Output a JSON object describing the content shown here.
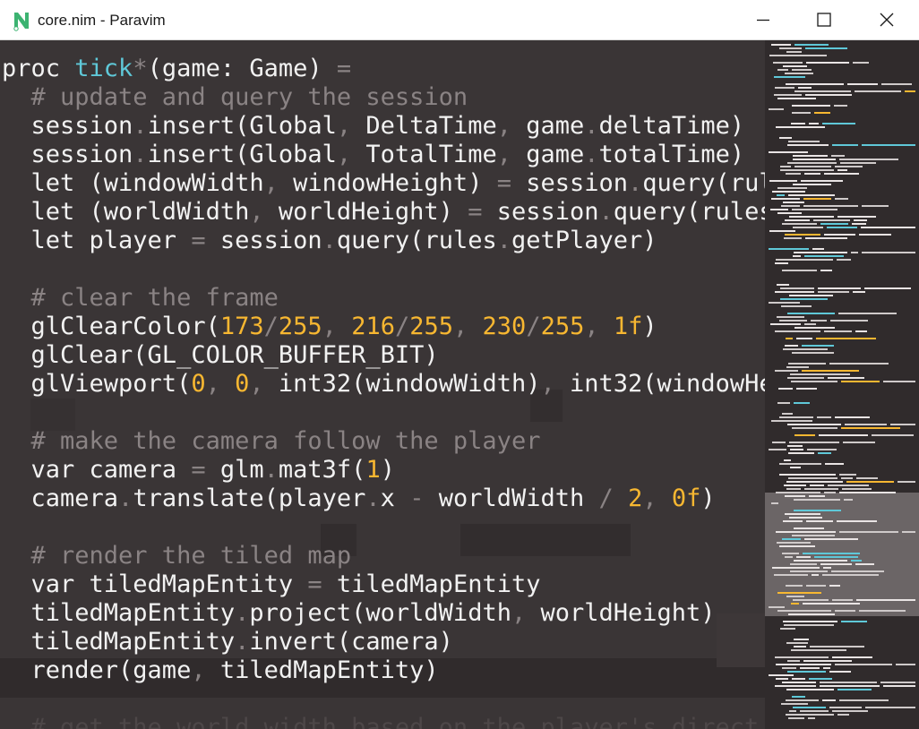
{
  "window": {
    "title": "core.nim - Paravim",
    "logo": "paravim-logo-icon",
    "controls": {
      "minimize": "minimize-icon",
      "maximize": "maximize-icon",
      "close": "close-icon"
    }
  },
  "colors": {
    "editor_bg": "#3a3536",
    "keyword": "#f2f2f2",
    "function": "#5fc8d8",
    "comment": "#8a8384",
    "number": "#f7b731",
    "logo_green": "#3cb371"
  },
  "code": {
    "lines": [
      [
        [
          "t-kw",
          "proc "
        ],
        [
          "t-fn",
          "tick"
        ],
        [
          "t-op",
          "*"
        ],
        [
          "t-tx",
          "(game: Game) "
        ],
        [
          "t-op",
          "="
        ]
      ],
      [
        [
          "t-cm",
          "  # update and query the session"
        ]
      ],
      [
        [
          "t-tx",
          "  session"
        ],
        [
          "t-op",
          "."
        ],
        [
          "t-tx",
          "insert(Global"
        ],
        [
          "t-op",
          ", "
        ],
        [
          "t-tx",
          "DeltaTime"
        ],
        [
          "t-op",
          ", "
        ],
        [
          "t-tx",
          "game"
        ],
        [
          "t-op",
          "."
        ],
        [
          "t-tx",
          "deltaTime)"
        ]
      ],
      [
        [
          "t-tx",
          "  session"
        ],
        [
          "t-op",
          "."
        ],
        [
          "t-tx",
          "insert(Global"
        ],
        [
          "t-op",
          ", "
        ],
        [
          "t-tx",
          "TotalTime"
        ],
        [
          "t-op",
          ", "
        ],
        [
          "t-tx",
          "game"
        ],
        [
          "t-op",
          "."
        ],
        [
          "t-tx",
          "totalTime)"
        ]
      ],
      [
        [
          "t-tx",
          "  let (windowWidth"
        ],
        [
          "t-op",
          ", "
        ],
        [
          "t-tx",
          "windowHeight) "
        ],
        [
          "t-op",
          "="
        ],
        [
          "t-tx",
          " session"
        ],
        [
          "t-op",
          "."
        ],
        [
          "t-tx",
          "query(rule"
        ]
      ],
      [
        [
          "t-tx",
          "  let (worldWidth"
        ],
        [
          "t-op",
          ", "
        ],
        [
          "t-tx",
          "worldHeight) "
        ],
        [
          "t-op",
          "="
        ],
        [
          "t-tx",
          " session"
        ],
        [
          "t-op",
          "."
        ],
        [
          "t-tx",
          "query(rules"
        ]
      ],
      [
        [
          "t-tx",
          "  let player "
        ],
        [
          "t-op",
          "="
        ],
        [
          "t-tx",
          " session"
        ],
        [
          "t-op",
          "."
        ],
        [
          "t-tx",
          "query(rules"
        ],
        [
          "t-op",
          "."
        ],
        [
          "t-tx",
          "getPlayer)"
        ]
      ],
      [
        [
          "t-tx",
          " "
        ]
      ],
      [
        [
          "t-cm",
          "  # clear the frame"
        ]
      ],
      [
        [
          "t-tx",
          "  glClearColor("
        ],
        [
          "t-num",
          "173"
        ],
        [
          "t-op",
          "/"
        ],
        [
          "t-num",
          "255"
        ],
        [
          "t-op",
          ", "
        ],
        [
          "t-num",
          "216"
        ],
        [
          "t-op",
          "/"
        ],
        [
          "t-num",
          "255"
        ],
        [
          "t-op",
          ", "
        ],
        [
          "t-num",
          "230"
        ],
        [
          "t-op",
          "/"
        ],
        [
          "t-num",
          "255"
        ],
        [
          "t-op",
          ", "
        ],
        [
          "t-num",
          "1f"
        ],
        [
          "t-tx",
          ")"
        ]
      ],
      [
        [
          "t-tx",
          "  glClear(GL_COLOR_BUFFER_BIT)"
        ]
      ],
      [
        [
          "t-tx",
          "  glViewport("
        ],
        [
          "t-num",
          "0"
        ],
        [
          "t-op",
          ", "
        ],
        [
          "t-num",
          "0"
        ],
        [
          "t-op",
          ", "
        ],
        [
          "t-tx",
          "int32(windowWidth)"
        ],
        [
          "t-op",
          ", "
        ],
        [
          "t-tx",
          "int32(windowHe"
        ]
      ],
      [
        [
          "t-tx",
          " "
        ]
      ],
      [
        [
          "t-cm",
          "  # make the camera follow the player"
        ]
      ],
      [
        [
          "t-tx",
          "  var camera "
        ],
        [
          "t-op",
          "="
        ],
        [
          "t-tx",
          " glm"
        ],
        [
          "t-op",
          "."
        ],
        [
          "t-tx",
          "mat3f("
        ],
        [
          "t-num",
          "1"
        ],
        [
          "t-tx",
          ")"
        ]
      ],
      [
        [
          "t-tx",
          "  camera"
        ],
        [
          "t-op",
          "."
        ],
        [
          "t-tx",
          "translate(player"
        ],
        [
          "t-op",
          "."
        ],
        [
          "t-tx",
          "x "
        ],
        [
          "t-op",
          "-"
        ],
        [
          "t-tx",
          " worldWidth "
        ],
        [
          "t-op",
          "/"
        ],
        [
          "t-tx",
          " "
        ],
        [
          "t-num",
          "2"
        ],
        [
          "t-op",
          ", "
        ],
        [
          "t-num",
          "0f"
        ],
        [
          "t-tx",
          ")"
        ]
      ],
      [
        [
          "t-tx",
          " "
        ]
      ],
      [
        [
          "t-cm",
          "  # render the tiled map"
        ]
      ],
      [
        [
          "t-tx",
          "  var tiledMapEntity "
        ],
        [
          "t-op",
          "="
        ],
        [
          "t-tx",
          " tiledMapEntity"
        ]
      ],
      [
        [
          "t-tx",
          "  tiledMapEntity"
        ],
        [
          "t-op",
          "."
        ],
        [
          "t-tx",
          "project(worldWidth"
        ],
        [
          "t-op",
          ", "
        ],
        [
          "t-tx",
          "worldHeight)"
        ]
      ],
      [
        [
          "t-tx",
          "  tiledMapEntity"
        ],
        [
          "t-op",
          "."
        ],
        [
          "t-tx",
          "invert(camera)"
        ]
      ],
      [
        [
          "t-tx",
          "  render(game"
        ],
        [
          "t-op",
          ", "
        ],
        [
          "t-tx",
          "tiledMapEntity)"
        ]
      ],
      [
        [
          "t-tx",
          " "
        ]
      ],
      [
        [
          "ghost",
          "  # get the world width based on the player's direct"
        ]
      ]
    ]
  }
}
